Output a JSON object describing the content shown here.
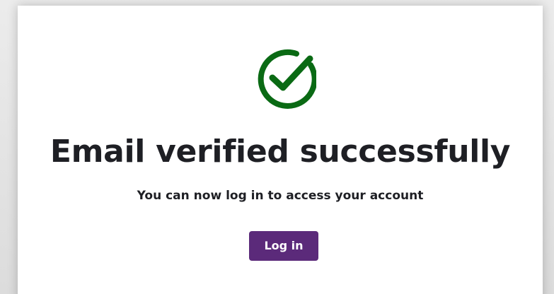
{
  "colors": {
    "success": "#0a6a14",
    "button_background": "#5b2a7a",
    "button_text": "#ffffff",
    "text": "#1e1f24",
    "card_background": "#ffffff",
    "page_background": "#e3e3e3"
  },
  "icon": {
    "name": "check-circle-icon"
  },
  "verification": {
    "title": "Email verified successfully",
    "message": "You can now log in to access your account",
    "login_button_label": "Log in"
  }
}
